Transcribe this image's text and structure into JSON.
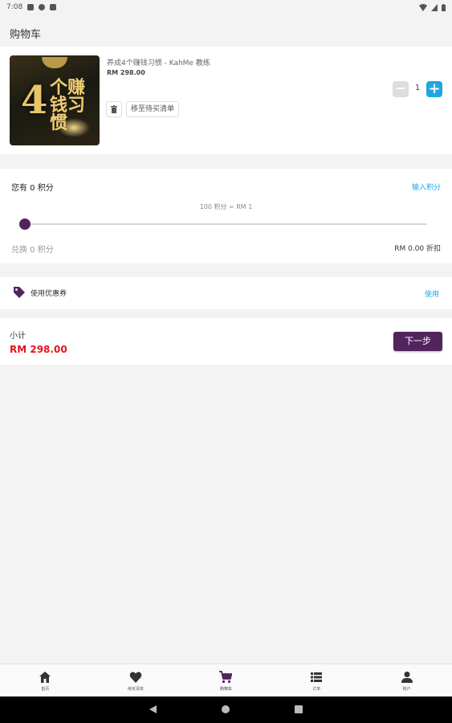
{
  "status_bar": {
    "time": "7:08"
  },
  "app_bar": {
    "title": "购物车"
  },
  "cart": {
    "item": {
      "image_text_number": "4",
      "image_text_chars": "个赚钱习惯",
      "title": "养成4个赚钱习惯 - KahMe 教练",
      "price": "RM 298.00",
      "wishlist_label": "移至待买清单",
      "quantity": "1",
      "minus_label": "−",
      "plus_label": "+"
    }
  },
  "points": {
    "have_label": "您有 0 积分",
    "input_link": "输入积分",
    "rate_text": "100 积分 = RM 1",
    "slider_value": 0,
    "redeem_label": "兑换 0 积分",
    "discount_text": "RM 0.00 折扣"
  },
  "coupon": {
    "label": "使用优惠券",
    "use_link": "使用"
  },
  "summary": {
    "subtotal_label": "小计",
    "subtotal_value": "RM 298.00",
    "next_button": "下一步"
  },
  "bottom_nav": {
    "items": [
      {
        "label": "首页",
        "icon": "home-icon"
      },
      {
        "label": "待买清单",
        "icon": "heart-icon"
      },
      {
        "label": "购物车",
        "icon": "cart-icon"
      },
      {
        "label": "订单",
        "icon": "list-icon"
      },
      {
        "label": "帐户",
        "icon": "person-icon"
      }
    ],
    "active_index": 2
  },
  "colors": {
    "accent_purple": "#52245e",
    "link_blue": "#1ea7e1",
    "price_red": "#e4141e"
  }
}
